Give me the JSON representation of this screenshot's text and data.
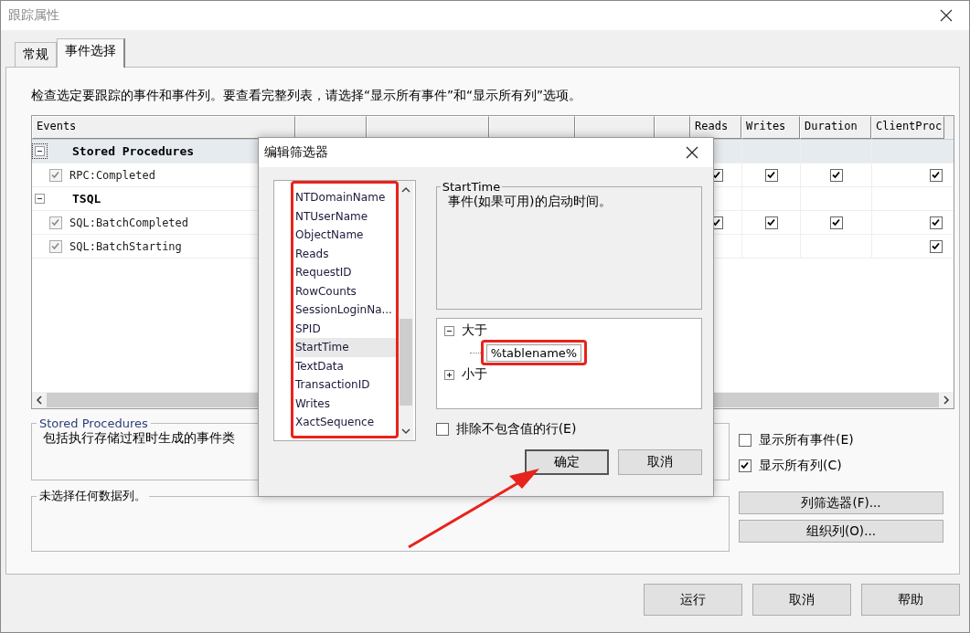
{
  "window": {
    "title": "跟踪属性"
  },
  "tabs": [
    {
      "label": "常规",
      "selected": false
    },
    {
      "label": "事件选择",
      "selected": true
    }
  ],
  "instructions": "检查选定要跟踪的事件和事件列。要查看完整列表，请选择“显示所有事件”和“显示所有列”选项。",
  "events_grid": {
    "columns": [
      {
        "label": "Events"
      },
      {
        "label": "Reads"
      },
      {
        "label": "Writes"
      },
      {
        "label": "Duration"
      },
      {
        "label": "ClientProc"
      }
    ],
    "rows": [
      {
        "kind": "category",
        "name": "Stored Procedures",
        "expanded": true,
        "selected": true
      },
      {
        "kind": "event",
        "name": "RPC:Completed",
        "checked": true,
        "selected": false,
        "cells": [
          true,
          true,
          true,
          true
        ]
      },
      {
        "kind": "category",
        "name": "TSQL",
        "expanded": true,
        "selected": false
      },
      {
        "kind": "event",
        "name": "SQL:BatchCompleted",
        "checked": true,
        "selected": false,
        "cells": [
          true,
          true,
          true,
          true
        ]
      },
      {
        "kind": "event",
        "name": "SQL:BatchStarting",
        "checked": true,
        "selected": false,
        "cells": [
          false,
          false,
          false,
          true
        ]
      }
    ]
  },
  "event_description": {
    "title": "Stored Procedures",
    "text": "包括执行存储过程时生成的事件类"
  },
  "column_description": {
    "title": "未选择任何数据列。"
  },
  "options": [
    {
      "label": "显示所有事件(E)",
      "checked": false
    },
    {
      "label": "显示所有列(C)",
      "checked": true
    }
  ],
  "side_buttons": [
    "列筛选器(F)...",
    "组织列(O)..."
  ],
  "footer_buttons": [
    "运行",
    "取消",
    "帮助"
  ],
  "filter_dialog": {
    "title": "编辑筛选器",
    "columns": [
      {
        "label": "NTDomainName",
        "selected": false
      },
      {
        "label": "NTUserName",
        "selected": false
      },
      {
        "label": "ObjectName",
        "selected": false
      },
      {
        "label": "Reads",
        "selected": false
      },
      {
        "label": "RequestID",
        "selected": false
      },
      {
        "label": "RowCounts",
        "selected": false
      },
      {
        "label": "SessionLoginNa...",
        "selected": false
      },
      {
        "label": "SPID",
        "selected": false
      },
      {
        "label": "StartTime",
        "selected": true
      },
      {
        "label": "TextData",
        "selected": false
      },
      {
        "label": "TransactionID",
        "selected": false
      },
      {
        "label": "Writes",
        "selected": false
      },
      {
        "label": "XactSequence",
        "selected": false
      }
    ],
    "description_title": "StartTime",
    "description": "事件(如果可用)的启动时间。",
    "conditions": [
      {
        "label": "大于",
        "expanded": true,
        "children": [
          {
            "value": "%tablename%"
          }
        ]
      },
      {
        "label": "小于",
        "expanded": false
      }
    ],
    "exclude_empty": {
      "label": "排除不包含值的行(E)",
      "checked": false
    },
    "buttons": [
      "确定",
      "取消"
    ]
  }
}
